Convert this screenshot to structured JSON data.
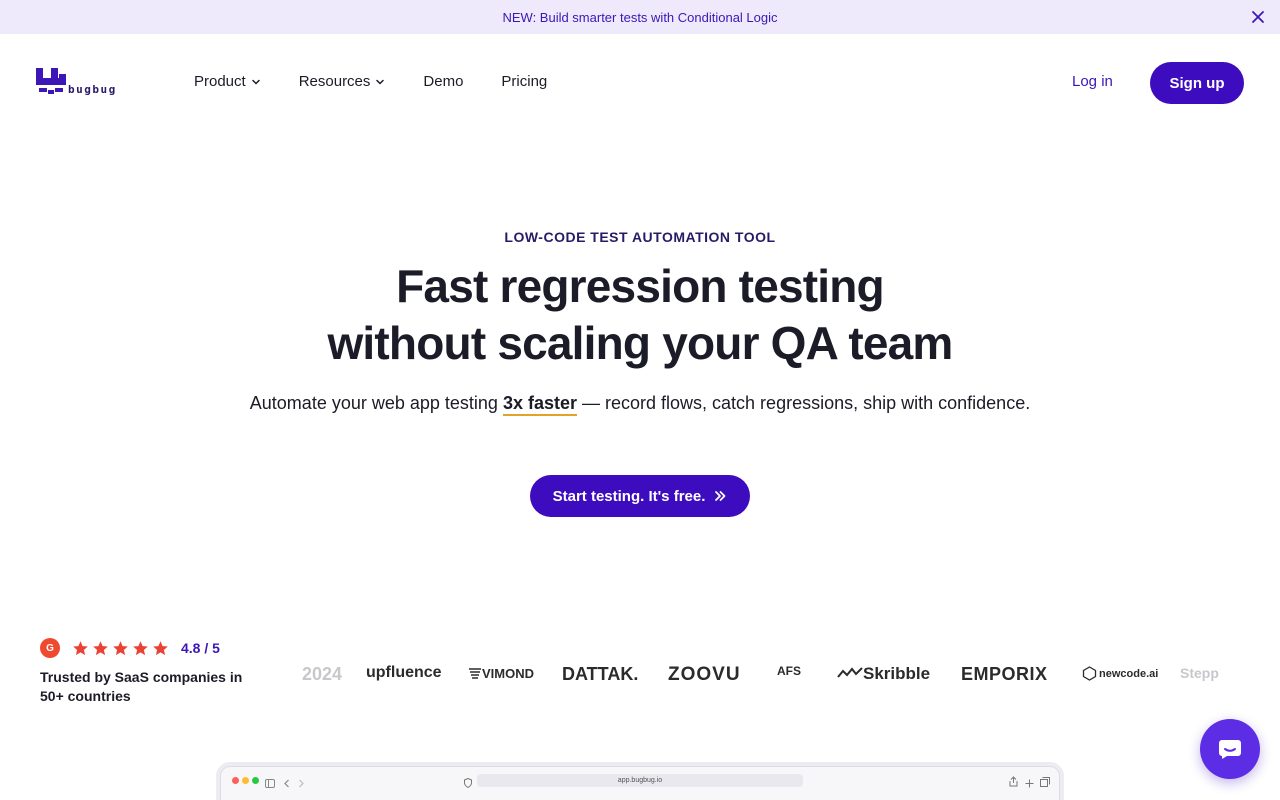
{
  "announcement": {
    "text": "NEW: Build smarter tests with Conditional Logic"
  },
  "brand": {
    "name": "bugbug"
  },
  "nav": {
    "items": [
      {
        "label": "Product",
        "has_dropdown": true
      },
      {
        "label": "Resources",
        "has_dropdown": true
      },
      {
        "label": "Demo",
        "has_dropdown": false
      },
      {
        "label": "Pricing",
        "has_dropdown": false
      }
    ],
    "login": "Log in",
    "signup": "Sign up"
  },
  "hero": {
    "eyebrow": "LOW-CODE TEST AUTOMATION TOOL",
    "headline_line1": "Fast regression testing",
    "headline_line2": "without scaling your QA team",
    "sub_before": "Automate your web app testing ",
    "sub_highlight": "3x faster",
    "sub_after": " — record flows, catch regressions, ship with confidence.",
    "cta": "Start testing. It's free."
  },
  "social_proof": {
    "badge": "G",
    "stars": 5,
    "score": "4.8 / 5",
    "trusted": "Trusted by SaaS companies in 50+ countries",
    "customer_logos": [
      "2024",
      "upfluence",
      "VIMOND",
      "DATTAK.",
      "ZOOVU",
      "AFS",
      "Skribble",
      "EMPORIX",
      "newcode.ai",
      "Stepp"
    ]
  },
  "browser_preview": {
    "url": "app.bugbug.io"
  },
  "colors": {
    "accent": "#3d0cbf",
    "announce_bg": "#eeeafb",
    "star": "#ea4335",
    "underline": "#e0a42a"
  }
}
